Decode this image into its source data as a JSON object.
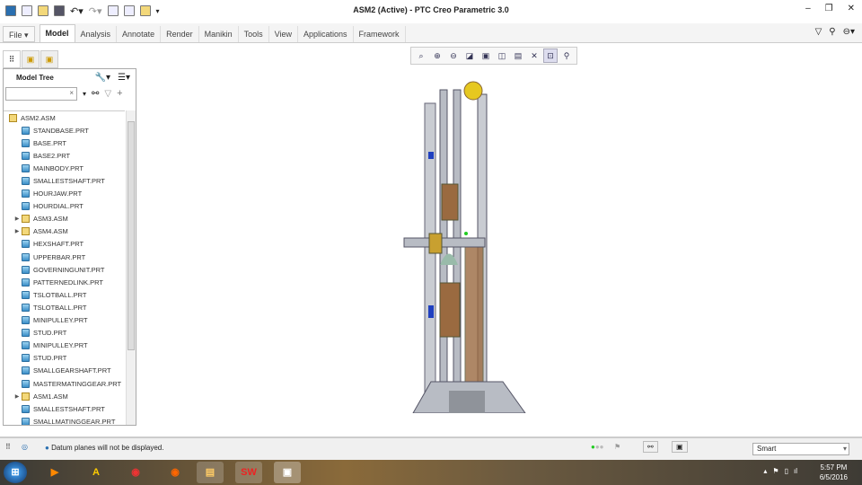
{
  "window": {
    "title": "ASM2 (Active) - PTC Creo Parametric 3.0"
  },
  "ribbon": {
    "tabs": [
      "File ▾",
      "Model",
      "Analysis",
      "Annotate",
      "Render",
      "Manikin",
      "Tools",
      "View",
      "Applications",
      "Framework"
    ],
    "active": "Model"
  },
  "model_tree": {
    "title": "Model Tree",
    "search_value": "",
    "items": [
      {
        "name": "ASM2.ASM",
        "type": "asm",
        "level": 0
      },
      {
        "name": "STANDBASE.PRT",
        "type": "prt"
      },
      {
        "name": "BASE.PRT",
        "type": "prt"
      },
      {
        "name": "BASE2.PRT",
        "type": "prt"
      },
      {
        "name": "MAINBODY.PRT",
        "type": "prt"
      },
      {
        "name": "SMALLESTSHAFT.PRT",
        "type": "prt"
      },
      {
        "name": "HOURJAW.PRT",
        "type": "prt"
      },
      {
        "name": "HOURDIAL.PRT",
        "type": "prt"
      },
      {
        "name": "ASM3.ASM",
        "type": "asm",
        "expandable": true
      },
      {
        "name": "ASM4.ASM",
        "type": "asm",
        "expandable": true
      },
      {
        "name": "HEXSHAFT.PRT",
        "type": "prt"
      },
      {
        "name": "UPPERBAR.PRT",
        "type": "prt"
      },
      {
        "name": "GOVERNINGUNIT.PRT",
        "type": "prt"
      },
      {
        "name": "PATTERNEDLINK.PRT",
        "type": "prt"
      },
      {
        "name": "TSLOTBALL.PRT",
        "type": "prt"
      },
      {
        "name": "TSLOTBALL.PRT",
        "type": "prt"
      },
      {
        "name": "MINIPULLEY.PRT",
        "type": "prt"
      },
      {
        "name": "STUD.PRT",
        "type": "prt"
      },
      {
        "name": "MINIPULLEY.PRT",
        "type": "prt"
      },
      {
        "name": "STUD.PRT",
        "type": "prt"
      },
      {
        "name": "SMALLGEARSHAFT.PRT",
        "type": "prt"
      },
      {
        "name": "MASTERMATINGGEAR.PRT",
        "type": "prt"
      },
      {
        "name": "ASM1.ASM",
        "type": "asm",
        "expandable": true
      },
      {
        "name": "SMALLESTSHAFT.PRT",
        "type": "prt"
      },
      {
        "name": "SMALLMATINGGEAR.PRT",
        "type": "prt"
      }
    ]
  },
  "status": {
    "message": "Datum planes will not be displayed.",
    "filter": "Smart"
  },
  "taskbar": {
    "time": "5:57 PM",
    "date": "6/5/2016"
  }
}
